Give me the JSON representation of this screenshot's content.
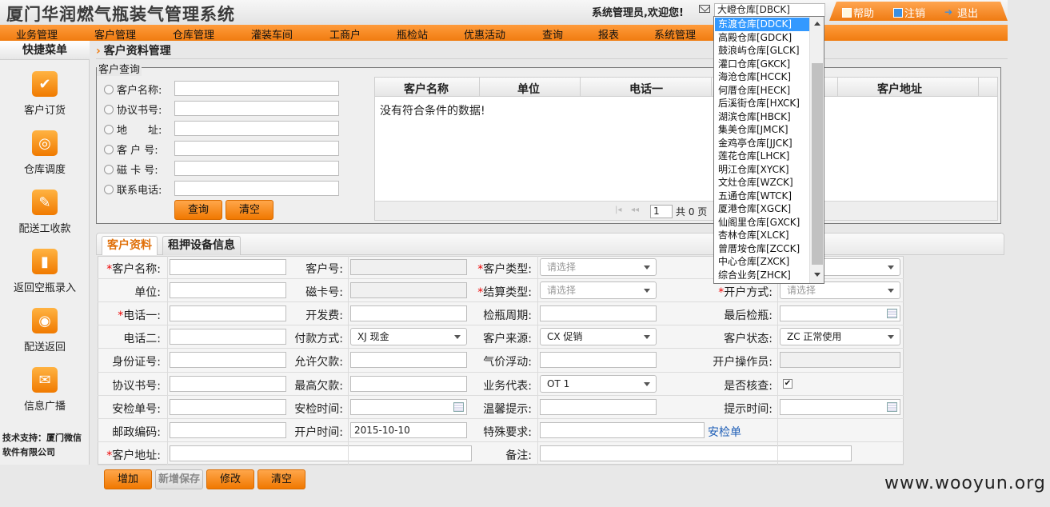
{
  "app": {
    "title": "厦门华润燃气瓶装气管理系统",
    "welcome": "系统管理员,欢迎您!",
    "current_warehouse": "大嶝仓库[DBCK]",
    "help": "帮助",
    "logout": "注销",
    "exit": "退出"
  },
  "nav": [
    "业务管理",
    "客户管理",
    "仓库管理",
    "灌装车间",
    "工商户",
    "瓶检站",
    "优惠活动",
    "查询",
    "报表",
    "系统管理"
  ],
  "sidebar": {
    "title": "快捷菜单",
    "items": [
      {
        "label": "客户订货",
        "icon": "check-icon"
      },
      {
        "label": "仓库调度",
        "icon": "target-icon"
      },
      {
        "label": "配送工收款",
        "icon": "edit-icon"
      },
      {
        "label": "返回空瓶录入",
        "icon": "battery-icon"
      },
      {
        "label": "配送返回",
        "icon": "broadcast-icon"
      },
      {
        "label": "信息广播",
        "icon": "mail-icon"
      }
    ],
    "support": "技术支持：厦门微信软件有限公司"
  },
  "page": {
    "title": "客户资料管理"
  },
  "query": {
    "legend": "客户查询",
    "fields": [
      "客户名称:",
      "协议书号:",
      "地　　址:",
      "客 户 号:",
      "磁 卡 号:",
      "联系电话:"
    ],
    "search_btn": "查询",
    "clear_btn": "清空"
  },
  "grid": {
    "columns": [
      "客户名称",
      "单位",
      "电话一",
      "客户地址"
    ],
    "empty": "没有符合条件的数据!",
    "page": "1",
    "total": "共 0 页"
  },
  "tabs": [
    "客户资料",
    "租押设备信息"
  ],
  "form": {
    "rows": [
      {
        "c1": {
          "label": "客户名称:",
          "req": true
        },
        "c2": {
          "label": "客户号:"
        },
        "c3": {
          "label": "客户类型:",
          "req": true,
          "select": "请选择"
        },
        "c4": {
          "label": "",
          "select": ""
        }
      },
      {
        "c1": {
          "label": "单位:"
        },
        "c2": {
          "label": "磁卡号:"
        },
        "c3": {
          "label": "结算类型:",
          "req": true,
          "select": "请选择"
        },
        "c4": {
          "label": "开户方式:",
          "req": true,
          "select": "请选择"
        }
      },
      {
        "c1": {
          "label": "电话一:",
          "req": true
        },
        "c2": {
          "label": "开发费:"
        },
        "c3": {
          "label": "检瓶周期:"
        },
        "c4": {
          "label": "最后检瓶:"
        }
      },
      {
        "c1": {
          "label": "电话二:"
        },
        "c2": {
          "label": "付款方式:",
          "select": "XJ 现金"
        },
        "c3": {
          "label": "客户来源:",
          "select": "CX 促销"
        },
        "c4": {
          "label": "客户状态:",
          "select": "ZC 正常使用"
        }
      },
      {
        "c1": {
          "label": "身份证号:"
        },
        "c2": {
          "label": "允许欠款:"
        },
        "c3": {
          "label": "气价浮动:"
        },
        "c4": {
          "label": "开户操作员:"
        }
      },
      {
        "c1": {
          "label": "协议书号:"
        },
        "c2": {
          "label": "最高欠款:"
        },
        "c3": {
          "label": "业务代表:",
          "select": "OT 1"
        },
        "c4": {
          "label": "是否核查:"
        }
      },
      {
        "c1": {
          "label": "安检单号:"
        },
        "c2": {
          "label": "安检时间:"
        },
        "c3": {
          "label": "温馨提示:"
        },
        "c4": {
          "label": "提示时间:"
        }
      },
      {
        "c1": {
          "label": "邮政编码:"
        },
        "c2": {
          "label": "开户时间:",
          "value": "2015-10-10"
        },
        "c3": {
          "label": "特殊要求:"
        },
        "c4": {
          "label": "安检单"
        }
      },
      {
        "c1": {
          "label": "客户地址:",
          "req": true
        },
        "c3": {
          "label": "备注:"
        }
      }
    ],
    "checked": "✔"
  },
  "buttons": {
    "add": "增加",
    "save_new": "新增保存",
    "edit": "修改",
    "clear": "清空"
  },
  "dropdown": {
    "options": [
      "东渡仓库[DDCK]",
      "高殿仓库[GDCK]",
      "鼓浪屿仓库[GLCK]",
      "灌口仓库[GKCK]",
      "海沧仓库[HCCK]",
      "何厝仓库[HECK]",
      "后溪街仓库[HXCK]",
      "湖滨仓库[HBCK]",
      "集美仓库[JMCK]",
      "金鸡亭仓库[JJCK]",
      "莲花仓库[LHCK]",
      "明江仓库[XYCK]",
      "文灶仓库[WZCK]",
      "五通仓库[WTCK]",
      "厦港仓库[XGCK]",
      "仙阁里仓库[GXCK]",
      "杏林仓库[XLCK]",
      "曾厝垵仓库[ZCCK]",
      "中心仓库[ZXCK]",
      "综合业务[ZHCK]"
    ],
    "selected_index": 0
  },
  "watermark": "www.wooyun.org",
  "colors": {
    "accent": "#f07c10",
    "select_blue": "#3399ff"
  }
}
